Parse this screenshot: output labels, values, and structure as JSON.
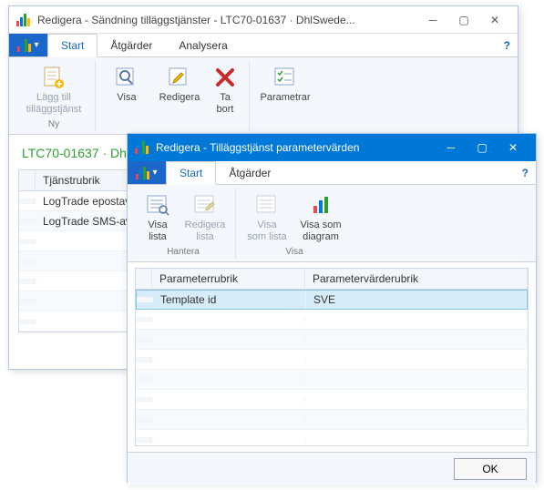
{
  "back": {
    "title": "Redigera - Sändning tilläggstjänster - LTC70-01637 · DhlSwede...",
    "tabs": {
      "start": "Start",
      "actions": "Åtgärder",
      "analyze": "Analysera"
    },
    "ribbon": {
      "add": {
        "l1": "Lägg till",
        "l2": "tilläggstjänst"
      },
      "view": "Visa",
      "edit": "Redigera",
      "delete": {
        "l1": "Ta",
        "l2": "bort"
      },
      "params": "Parametrar",
      "group_new": "Ny"
    },
    "breadcrumb": "LTC70-01637 · Dh",
    "grid": {
      "header": "Tjänstrubrik",
      "rows": [
        "LogTrade epostav",
        "LogTrade SMS-av"
      ]
    }
  },
  "front": {
    "title": "Redigera - Tilläggstjänst parametervärden",
    "tabs": {
      "start": "Start",
      "actions": "Åtgärder"
    },
    "ribbon": {
      "view_list": {
        "l1": "Visa",
        "l2": "lista"
      },
      "edit_list": {
        "l1": "Redigera",
        "l2": "lista"
      },
      "show_as_list": {
        "l1": "Visa",
        "l2": "som lista"
      },
      "show_as_chart": {
        "l1": "Visa som",
        "l2": "diagram"
      },
      "group_manage": "Hantera",
      "group_show": "Visa"
    },
    "grid": {
      "col1": "Parameterrubrik",
      "col2": "Parametervärderubrik",
      "rows": [
        {
          "param": "Template id",
          "value": "SVE"
        }
      ]
    },
    "ok": "OK"
  }
}
